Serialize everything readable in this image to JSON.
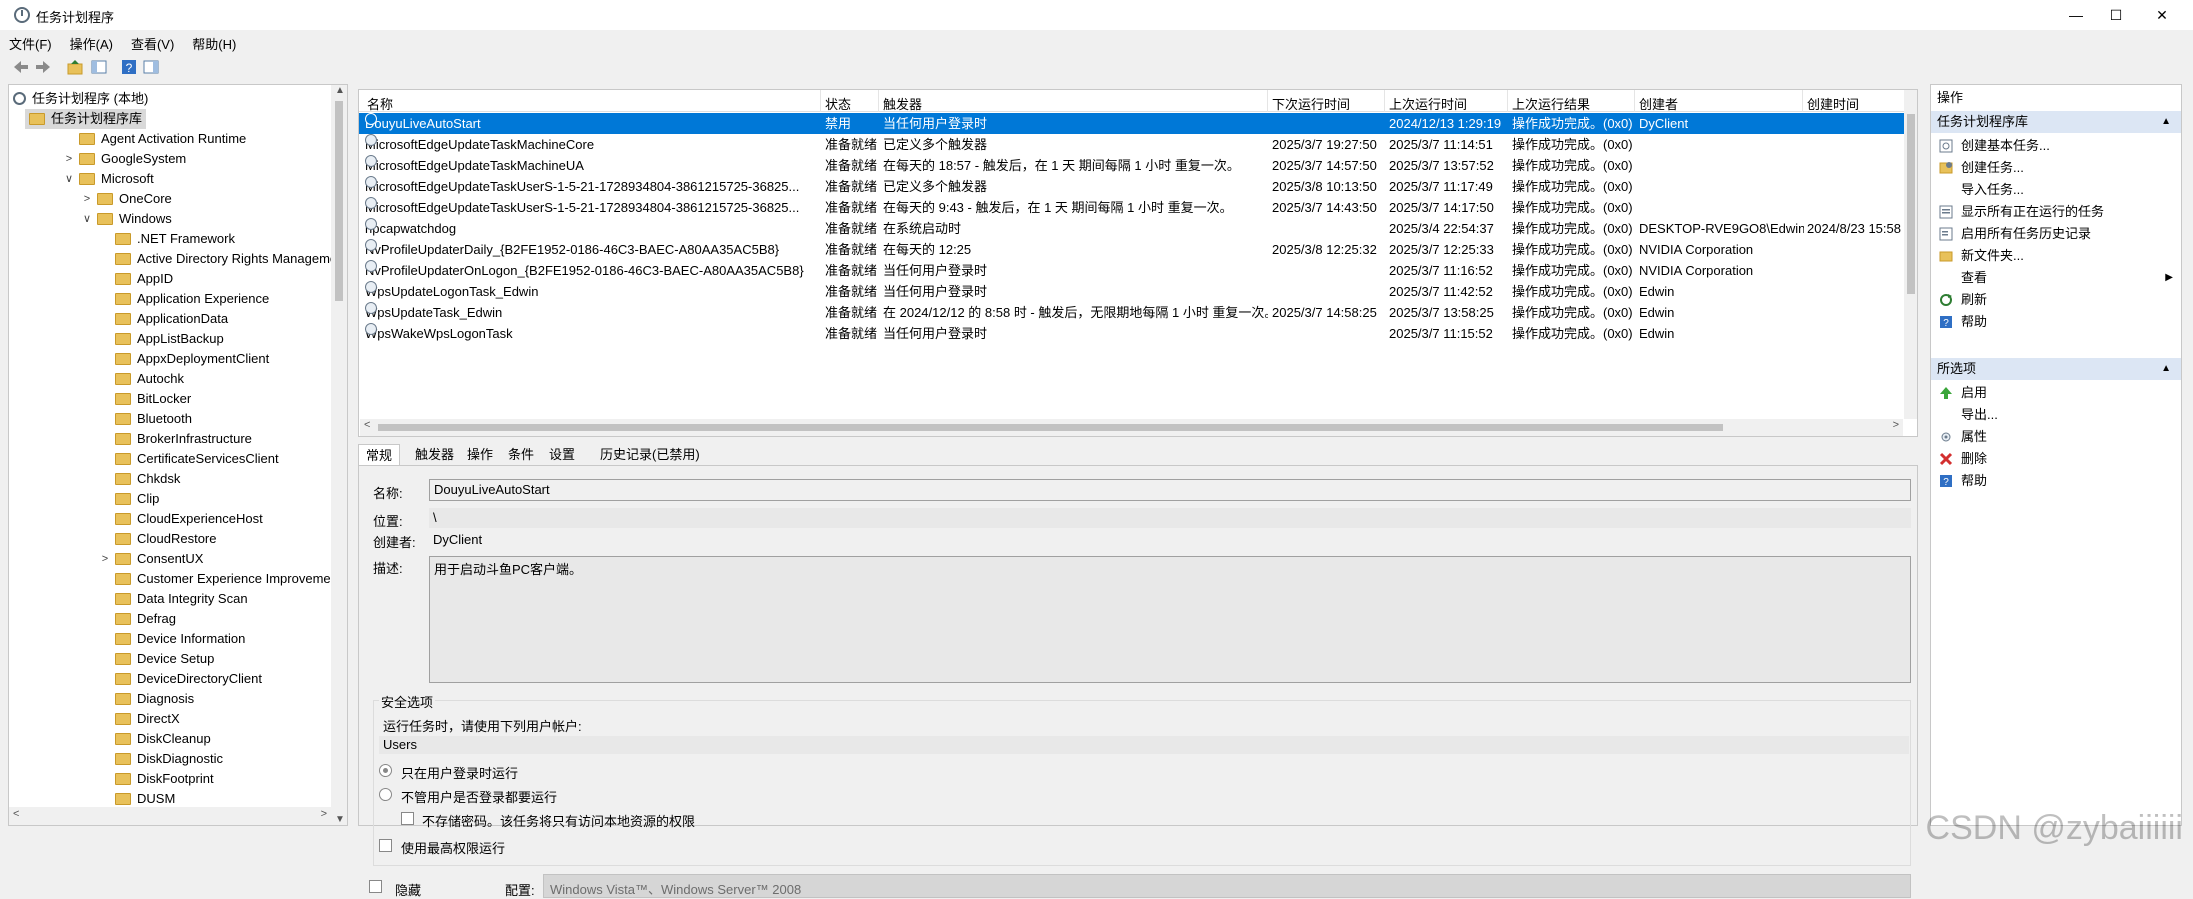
{
  "window": {
    "title": "任务计划程序",
    "minimize": "—",
    "maximize": "☐",
    "close": "✕"
  },
  "menu": [
    "文件(F)",
    "操作(A)",
    "查看(V)",
    "帮助(H)"
  ],
  "toolbar_icons": [
    "back-icon",
    "forward-icon",
    "up-folder-icon",
    "show-hide-tree-icon",
    "help-icon",
    "show-hide-action-pane-icon"
  ],
  "tree": {
    "items": [
      {
        "label": "任务计划程序 (本地)",
        "level": 0,
        "toggle": "",
        "icon": "clock-icon"
      },
      {
        "label": "任务计划程序库",
        "level": 1,
        "toggle": "∨",
        "icon": "library-icon",
        "selected": true
      },
      {
        "label": "Agent Activation Runtime",
        "level": 2,
        "toggle": ""
      },
      {
        "label": "GoogleSystem",
        "level": 2,
        "toggle": ">"
      },
      {
        "label": "Microsoft",
        "level": 2,
        "toggle": "∨"
      },
      {
        "label": "OneCore",
        "level": 3,
        "toggle": ">"
      },
      {
        "label": "Windows",
        "level": 3,
        "toggle": "∨"
      },
      {
        "label": ".NET Framework",
        "level": 4,
        "toggle": ""
      },
      {
        "label": "Active Directory Rights Management S",
        "level": 4,
        "toggle": ""
      },
      {
        "label": "AppID",
        "level": 4,
        "toggle": ""
      },
      {
        "label": "Application Experience",
        "level": 4,
        "toggle": ""
      },
      {
        "label": "ApplicationData",
        "level": 4,
        "toggle": ""
      },
      {
        "label": "AppListBackup",
        "level": 4,
        "toggle": ""
      },
      {
        "label": "AppxDeploymentClient",
        "level": 4,
        "toggle": ""
      },
      {
        "label": "Autochk",
        "level": 4,
        "toggle": ""
      },
      {
        "label": "BitLocker",
        "level": 4,
        "toggle": ""
      },
      {
        "label": "Bluetooth",
        "level": 4,
        "toggle": ""
      },
      {
        "label": "BrokerInfrastructure",
        "level": 4,
        "toggle": ""
      },
      {
        "label": "CertificateServicesClient",
        "level": 4,
        "toggle": ""
      },
      {
        "label": "Chkdsk",
        "level": 4,
        "toggle": ""
      },
      {
        "label": "Clip",
        "level": 4,
        "toggle": ""
      },
      {
        "label": "CloudExperienceHost",
        "level": 4,
        "toggle": ""
      },
      {
        "label": "CloudRestore",
        "level": 4,
        "toggle": ""
      },
      {
        "label": "ConsentUX",
        "level": 4,
        "toggle": ">"
      },
      {
        "label": "Customer Experience Improvement Pr",
        "level": 4,
        "toggle": ""
      },
      {
        "label": "Data Integrity Scan",
        "level": 4,
        "toggle": ""
      },
      {
        "label": "Defrag",
        "level": 4,
        "toggle": ""
      },
      {
        "label": "Device Information",
        "level": 4,
        "toggle": ""
      },
      {
        "label": "Device Setup",
        "level": 4,
        "toggle": ""
      },
      {
        "label": "DeviceDirectoryClient",
        "level": 4,
        "toggle": ""
      },
      {
        "label": "Diagnosis",
        "level": 4,
        "toggle": ""
      },
      {
        "label": "DirectX",
        "level": 4,
        "toggle": ""
      },
      {
        "label": "DiskCleanup",
        "level": 4,
        "toggle": ""
      },
      {
        "label": "DiskDiagnostic",
        "level": 4,
        "toggle": ""
      },
      {
        "label": "DiskFootprint",
        "level": 4,
        "toggle": ""
      },
      {
        "label": "DUSM",
        "level": 4,
        "toggle": ""
      }
    ]
  },
  "tasks": {
    "columns": [
      "名称",
      "状态",
      "触发器",
      "下次运行时间",
      "上次运行时间",
      "上次运行结果",
      "创建者",
      "创建时间"
    ],
    "rows": [
      [
        "DouyuLiveAutoStart",
        "禁用",
        "当任何用户登录时",
        "",
        "2024/12/13 1:29:19",
        "操作成功完成。(0x0)",
        "DyClient",
        ""
      ],
      [
        "MicrosoftEdgeUpdateTaskMachineCore",
        "准备就绪",
        "已定义多个触发器",
        "2025/3/7 19:27:50",
        "2025/3/7 11:14:51",
        "操作成功完成。(0x0)",
        "",
        ""
      ],
      [
        "MicrosoftEdgeUpdateTaskMachineUA",
        "准备就绪",
        "在每天的 18:57 - 触发后，在 1 天 期间每隔 1 小时 重复一次。",
        "2025/3/7 14:57:50",
        "2025/3/7 13:57:52",
        "操作成功完成。(0x0)",
        "",
        ""
      ],
      [
        "MicrosoftEdgeUpdateTaskUserS-1-5-21-1728934804-3861215725-36825...",
        "准备就绪",
        "已定义多个触发器",
        "2025/3/8 10:13:50",
        "2025/3/7 11:17:49",
        "操作成功完成。(0x0)",
        "",
        ""
      ],
      [
        "MicrosoftEdgeUpdateTaskUserS-1-5-21-1728934804-3861215725-36825...",
        "准备就绪",
        "在每天的 9:43 - 触发后，在 1 天 期间每隔 1 小时 重复一次。",
        "2025/3/7 14:43:50",
        "2025/3/7 14:17:50",
        "操作成功完成。(0x0)",
        "",
        ""
      ],
      [
        "npcapwatchdog",
        "准备就绪",
        "在系统启动时",
        "",
        "2025/3/4 22:54:37",
        "操作成功完成。(0x0)",
        "DESKTOP-RVE9GO8\\Edwin",
        "2024/8/23 15:58"
      ],
      [
        "NvProfileUpdaterDaily_{B2FE1952-0186-46C3-BAEC-A80AA35AC5B8}",
        "准备就绪",
        "在每天的 12:25",
        "2025/3/8 12:25:32",
        "2025/3/7 12:25:33",
        "操作成功完成。(0x0)",
        "NVIDIA Corporation",
        ""
      ],
      [
        "NvProfileUpdaterOnLogon_{B2FE1952-0186-46C3-BAEC-A80AA35AC5B8}",
        "准备就绪",
        "当任何用户登录时",
        "",
        "2025/3/7 11:16:52",
        "操作成功完成。(0x0)",
        "NVIDIA Corporation",
        ""
      ],
      [
        "WpsUpdateLogonTask_Edwin",
        "准备就绪",
        "当任何用户登录时",
        "",
        "2025/3/7 11:42:52",
        "操作成功完成。(0x0)",
        "Edwin",
        ""
      ],
      [
        "WpsUpdateTask_Edwin",
        "准备就绪",
        "在 2024/12/12 的 8:58 时 - 触发后，无限期地每隔 1 小时 重复一次。",
        "2025/3/7 14:58:25",
        "2025/3/7 13:58:25",
        "操作成功完成。(0x0)",
        "Edwin",
        ""
      ],
      [
        "WpsWakeWpsLogonTask",
        "准备就绪",
        "当任何用户登录时",
        "",
        "2025/3/7 11:15:52",
        "操作成功完成。(0x0)",
        "Edwin",
        ""
      ]
    ]
  },
  "tabs": [
    "常规",
    "触发器",
    "操作",
    "条件",
    "设置",
    "历史记录(已禁用)"
  ],
  "general": {
    "name_label": "名称:",
    "name_value": "DouyuLiveAutoStart",
    "location_label": "位置:",
    "location_value": "\\",
    "author_label": "创建者:",
    "author_value": "DyClient",
    "desc_label": "描述:",
    "desc_value": "用于启动斗鱼PC客户端。",
    "security_title": "安全选项",
    "run_as_text": "运行任务时，请使用下列用户帐户:",
    "user_account": "Users",
    "radio_logged_on": "只在用户登录时运行",
    "radio_whether": "不管用户是否登录都要运行",
    "no_store_password": "不存储密码。该任务将只有访问本地资源的权限",
    "highest_privileges": "使用最高权限运行",
    "hidden": "隐藏",
    "config_label": "配置:",
    "config_value": "Windows Vista™、Windows Server™ 2008"
  },
  "actions": {
    "header": "操作",
    "section1": "任务计划程序库",
    "section1_items": [
      {
        "label": "创建基本任务...",
        "icon": "create-basic-task-icon"
      },
      {
        "label": "创建任务...",
        "icon": "create-task-icon"
      },
      {
        "label": "导入任务...",
        "icon": ""
      },
      {
        "label": "显示所有正在运行的任务",
        "icon": "running-tasks-icon"
      },
      {
        "label": "启用所有任务历史记录",
        "icon": "history-icon"
      },
      {
        "label": "新文件夹...",
        "icon": "new-folder-icon"
      },
      {
        "label": "查看",
        "icon": "",
        "submenu": true
      },
      {
        "label": "刷新",
        "icon": "refresh-icon"
      },
      {
        "label": "帮助",
        "icon": "help-icon"
      }
    ],
    "section2": "所选项",
    "section2_items": [
      {
        "label": "启用",
        "icon": "enable-icon"
      },
      {
        "label": "导出...",
        "icon": ""
      },
      {
        "label": "属性",
        "icon": "properties-icon"
      },
      {
        "label": "删除",
        "icon": "delete-icon"
      },
      {
        "label": "帮助",
        "icon": "help-icon"
      }
    ]
  },
  "watermark": "CSDN @zybaiiiiii",
  "colors": {
    "selection": "#0078d7",
    "section_header": "#dce6f4"
  }
}
